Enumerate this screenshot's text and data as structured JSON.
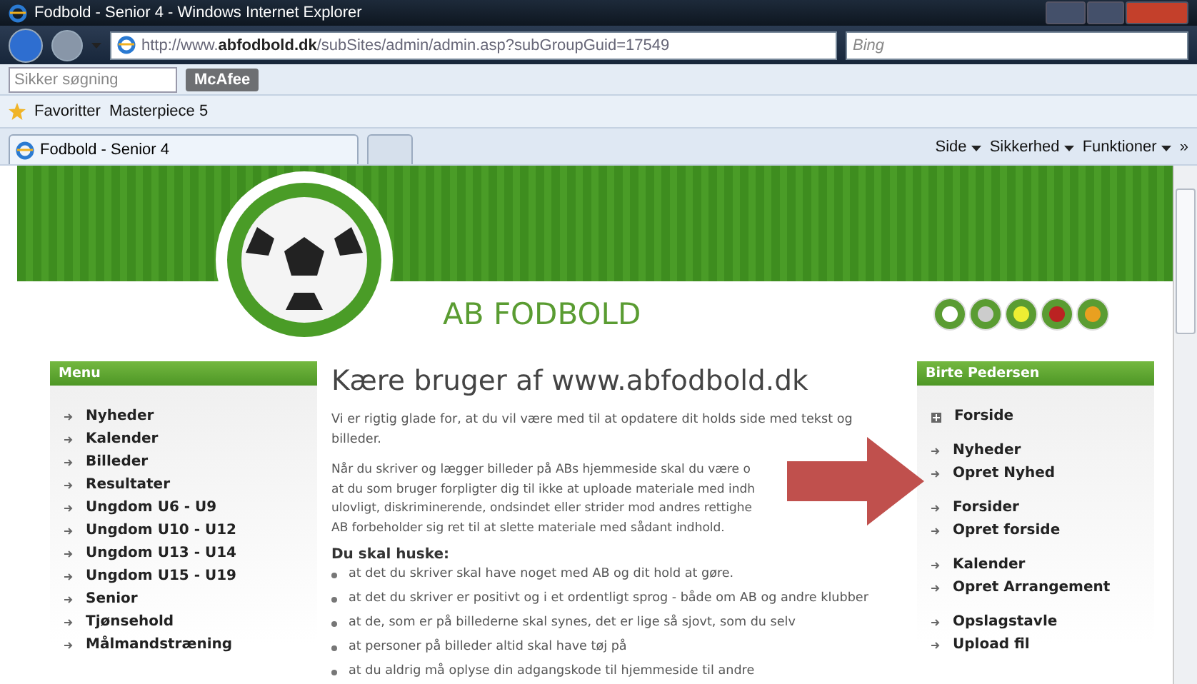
{
  "window": {
    "title": "Fodbold - Senior 4 - Windows Internet Explorer"
  },
  "address_bar": {
    "url": "http://www.**abfodbold.dk**/subSites/admin/admin.asp?subGroupGuid=17549",
    "search_placeholder": "Bing"
  },
  "toolbar": {
    "search_placeholder": "Sikker søgning",
    "brand_button": "McAfee"
  },
  "favorites_bar": {
    "items": [
      "Favoritter",
      "Masterpiece 5"
    ]
  },
  "tabs": [
    {
      "label": "Fodbold - Senior 4",
      "selected": true
    },
    {
      "selected": false
    }
  ],
  "command_bar": {
    "menus": [
      "Side",
      "Sikkerhed",
      "Funktioner"
    ],
    "more": "»"
  },
  "site": {
    "title": "AB FODBOLD"
  },
  "menu": {
    "title": "Menu",
    "items": [
      "Nyheder",
      "Kalender",
      "Billeder",
      "Resultater",
      "Ungdom U6 - U9",
      "Ungdom U10 - U12",
      "Ungdom U13 - U14",
      "Ungdom U15 - U19",
      "Senior",
      "Tjønsehold",
      "Målmandstræning"
    ]
  },
  "article": {
    "heading": "Kære bruger af www.abfodbold.dk",
    "intro": "Vi er rigtig glade for, at du vil være med til at opdatere dit holds side med tekst og billeder.",
    "terms_lines": [
      "Når du skriver og lægger billeder på ABs hjemmeside skal du være o",
      "at du som bruger forpligter dig til ikke at uploade materiale med indh",
      "ulovligt, diskriminerende, ondsindet eller strider mod andres rettighe",
      "AB forbeholder sig ret til at slette materiale med sådant indhold."
    ],
    "remember_title": "Du skal huske:",
    "bullets": [
      "at det du skriver skal have noget med AB og dit hold at gøre.",
      "at det du skriver er positivt og i et ordentligt sprog - både om AB og andre klubber",
      "at de, som er på billederne skal synes, det er lige så sjovt, som du selv",
      "at personer på billeder altid skal have tøj på",
      "at du aldrig må oplyse din adgangskode til hjemmeside til andre"
    ]
  },
  "user_panel": {
    "title": "Birte Pedersen",
    "groups": [
      [
        {
          "label": "Forside",
          "kind": "home"
        }
      ],
      [
        {
          "label": "Nyheder",
          "kind": "link"
        },
        {
          "label": "Opret Nyhed",
          "kind": "link"
        }
      ],
      [
        {
          "label": "Forsider",
          "kind": "link"
        },
        {
          "label": "Opret forside",
          "kind": "link"
        }
      ],
      [
        {
          "label": "Kalender",
          "kind": "link"
        },
        {
          "label": "Opret Arrangement",
          "kind": "link"
        }
      ],
      [
        {
          "label": "Opslagstavle",
          "kind": "link"
        },
        {
          "label": "Upload fil",
          "kind": "link"
        }
      ]
    ]
  }
}
